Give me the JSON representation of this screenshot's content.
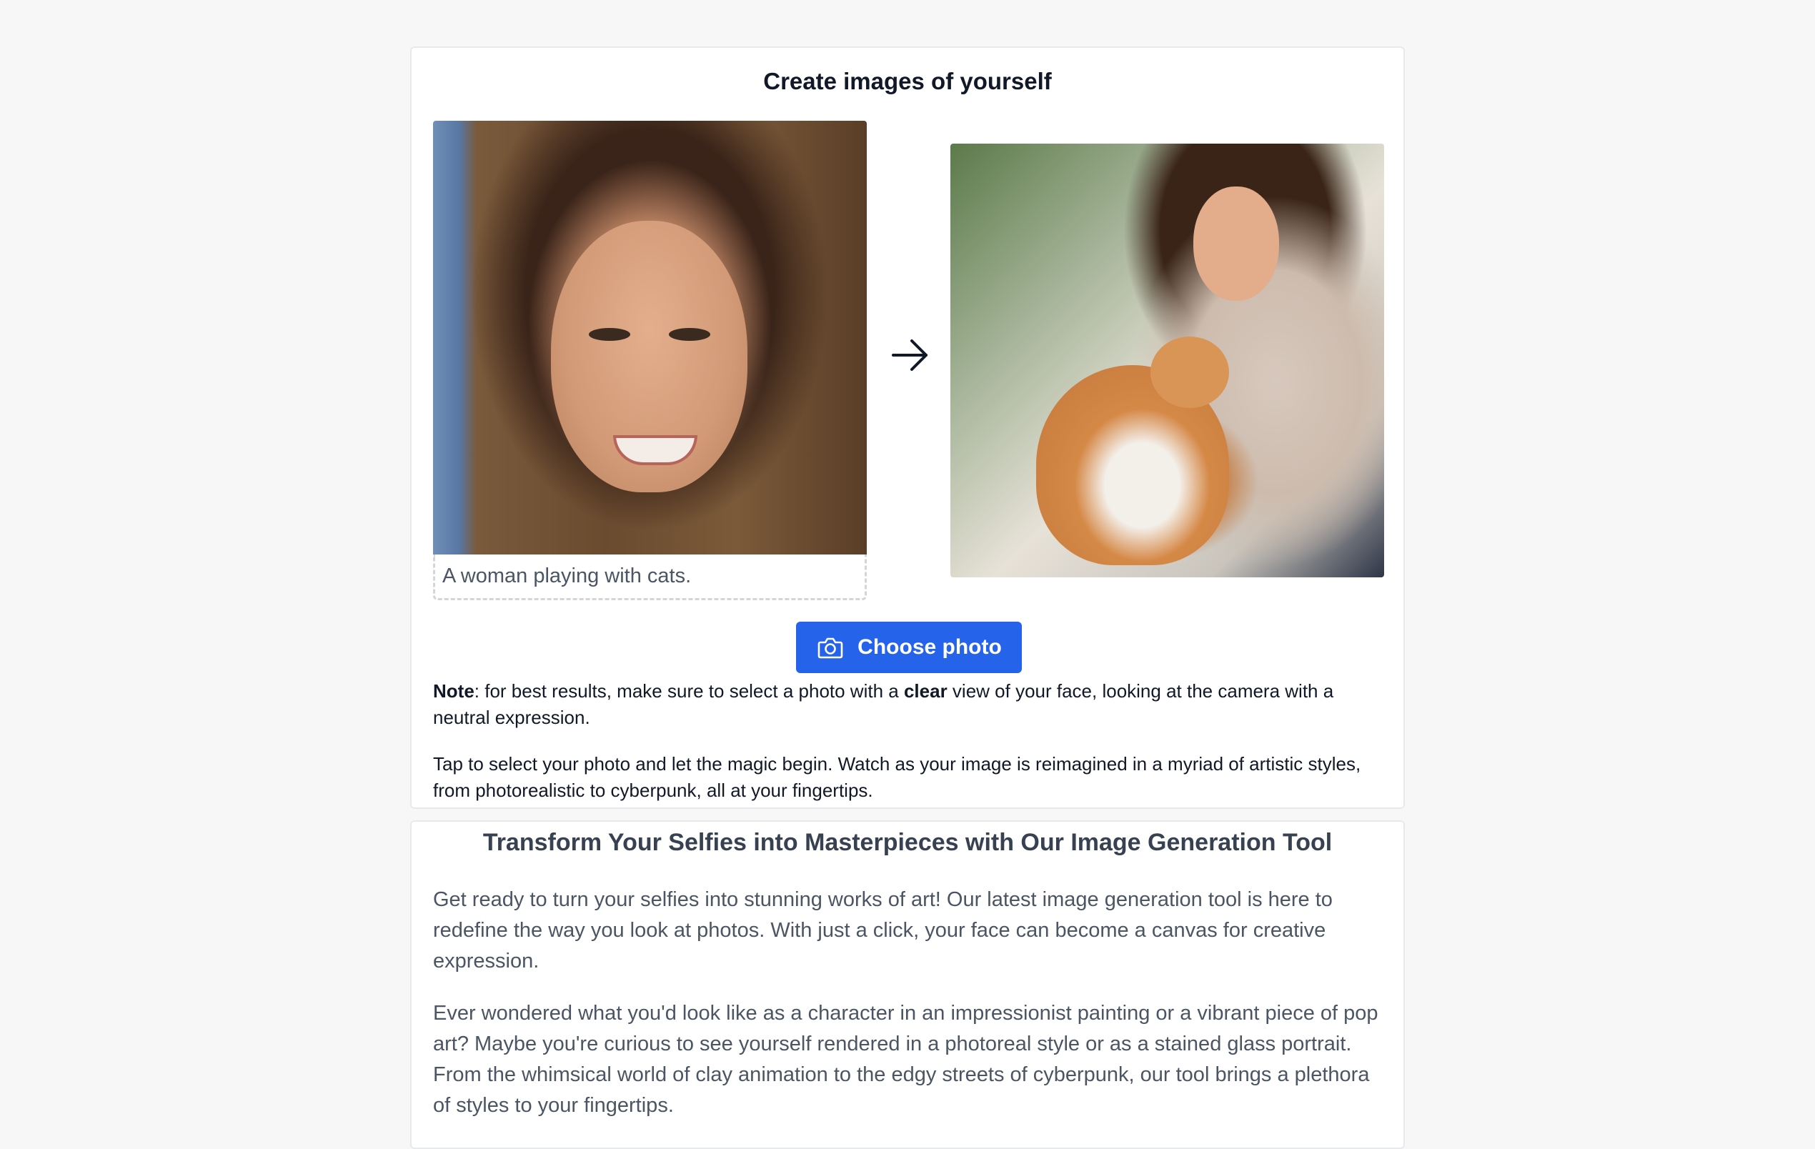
{
  "hero": {
    "title": "Create images of yourself",
    "caption": "A woman playing with cats.",
    "choose_button_label": "Choose photo",
    "note_label": "Note",
    "note_text_1": ": for best results, make sure to select a photo with a ",
    "note_emphasis": "clear",
    "note_text_2": " view of your face, looking at the camera with a neutral expression.",
    "tap_text": "Tap to select your photo and let the magic begin. Watch as your image is reimagined in a myriad of artistic styles, from photorealistic to cyberpunk, all at your fingertips."
  },
  "article": {
    "title": "Transform Your Selfies into Masterpieces with Our Image Generation Tool",
    "paragraph_1": "Get ready to turn your selfies into stunning works of art! Our latest image generation tool is here to redefine the way you look at photos. With just a click, your face can become a canvas for creative expression.",
    "paragraph_2": "Ever wondered what you'd look like as a character in an impressionist painting or a vibrant piece of pop art? Maybe you're curious to see yourself rendered in a photoreal style or as a stained glass portrait. From the whimsical world of clay animation to the edgy streets of cyberpunk, our tool brings a plethora of styles to your fingertips."
  },
  "icons": {
    "arrow": "arrow-right-icon",
    "camera": "camera-icon"
  },
  "colors": {
    "accent": "#2563eb",
    "page_background": "#f7f7f8"
  }
}
